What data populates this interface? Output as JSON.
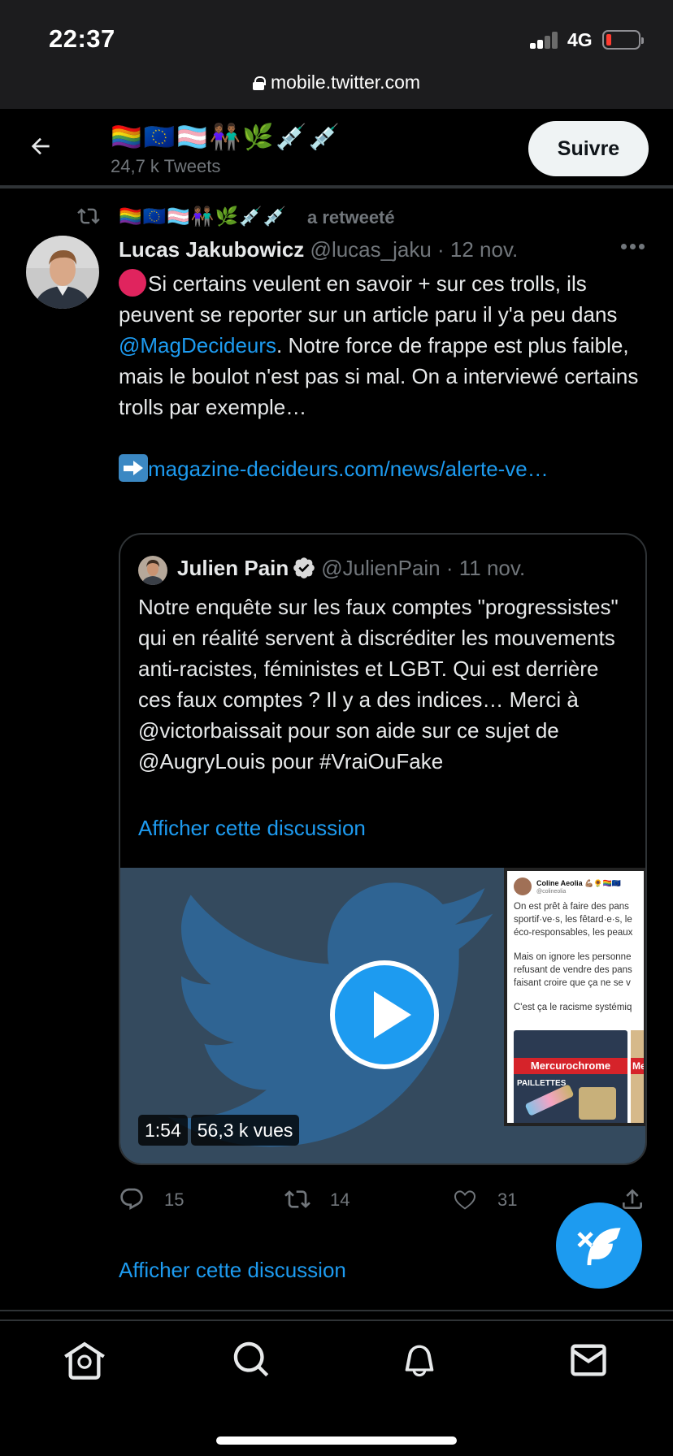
{
  "status_bar": {
    "time": "22:37",
    "network": "4G"
  },
  "browser": {
    "url": "mobile.twitter.com"
  },
  "header": {
    "profile_name_emoji": "🏳️‍🌈🇪🇺🏳️‍⚧️👫🏾🌿💉💉",
    "tweet_count": "24,7 k Tweets",
    "follow_label": "Suivre"
  },
  "tweet": {
    "retweeted_by_emoji": "🏳️‍🌈🇪🇺🏳️‍⚧️👫🏾🌿💉💉",
    "retweeted_label": "a retweeté",
    "author_name": "Lucas Jakubowicz",
    "author_handle": "@lucas_jaku · 12 nov.",
    "text_line1": "Si certains veulent en savoir + sur ces trolls, ils peuvent se reporter sur un article paru il y'a peu dans",
    "mention": "@MagDecideurs",
    "text_line2": ". Notre force de frappe est plus faible, mais le boulot n'est pas si mal. On a interviewé certains trolls par exemple…",
    "link": "magazine-decideurs.com/news/alerte-ve…",
    "quote": {
      "author_name": "Julien Pain",
      "author_handle": "@JulienPain · 11 nov.",
      "text": "Notre enquête sur les faux comptes \"progressistes\" qui en réalité servent à discréditer les mouvements anti-racistes, féministes et LGBT. Qui est derrière ces faux comptes ? Il y a des indices… Merci à @victorbaissait pour son aide sur ce sujet de @AugryLouis pour #VraiOuFake",
      "show_thread": "Afficher cette discussion",
      "video": {
        "duration": "1:54",
        "views": "56,3 k vues",
        "thumb_name": "Coline Aeolia 💪🏽🌻🏳️‍🌈🇪🇺",
        "thumb_handle": "@colineolia",
        "thumb_lines": [
          "On est prêt à faire des pans",
          "sportif·ve·s, les fêtard·e·s, le",
          "éco-responsables, les peaux",
          "",
          "Mais on ignore les personne",
          "refusant de vendre des pans",
          "faisant croire que ça ne se v",
          "",
          "C'est ça le racisme systémiq"
        ],
        "thumb_brand": "Mercurochrome",
        "thumb_brand_short": "Mer",
        "thumb_pack_label": "PAILLETTES"
      }
    },
    "replies": "15",
    "retweets": "14",
    "likes": "31",
    "show_thread": "Afficher cette discussion"
  }
}
